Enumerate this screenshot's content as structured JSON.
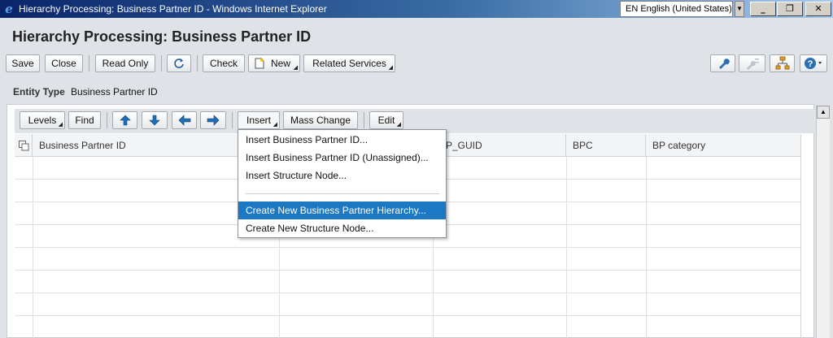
{
  "window": {
    "title": "Hierarchy Processing: Business Partner ID - Windows Internet Explorer",
    "language": "EN English (United States)",
    "minimize_glyph": "_",
    "maximize_glyph": "❐",
    "close_glyph": "✕"
  },
  "page": {
    "title": "Hierarchy Processing: Business Partner ID"
  },
  "toolbar": {
    "save": "Save",
    "close": "Close",
    "read_only": "Read Only",
    "check": "Check",
    "new": "New",
    "related_services": "Related Services",
    "right_icons": [
      "wrench-icon",
      "personalize-icon",
      "hierarchy-icon",
      "help-icon"
    ]
  },
  "entity": {
    "label": "Entity Type",
    "value": "Business Partner ID"
  },
  "grid_toolbar": {
    "levels": "Levels",
    "find": "Find",
    "insert": "Insert",
    "mass_change": "Mass Change",
    "edit": "Edit",
    "nav_icons": [
      "arrow-up-icon",
      "arrow-down-icon",
      "arrow-left-icon",
      "arrow-right-icon"
    ]
  },
  "table": {
    "columns": [
      "Business Partner ID",
      "",
      "BP_GUID",
      "BPC",
      "BP category"
    ],
    "row_count": 8
  },
  "insert_menu": {
    "items": [
      "Insert Business Partner ID...",
      "Insert Business Partner ID (Unassigned)...",
      "Insert Structure Node...",
      "Create New Business Partner Hierarchy...",
      "Create New Structure Node..."
    ],
    "selected_index": 3
  },
  "colors": {
    "title_bar_start": "#0a246a",
    "menu_highlight": "#1c78c2",
    "nav_arrow": "#1f6fb8",
    "background": "#dfe3e7"
  }
}
